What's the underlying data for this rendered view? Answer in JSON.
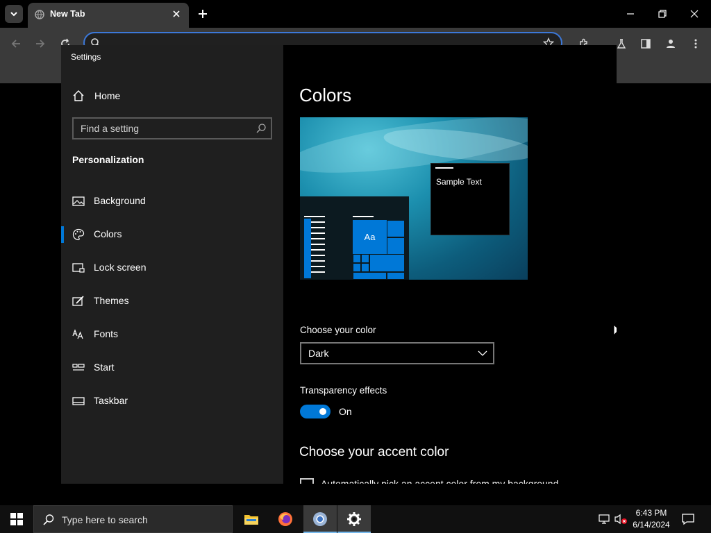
{
  "browser": {
    "tab_title": "New Tab",
    "omnibox_value": ""
  },
  "settings": {
    "window_title": "Settings",
    "home_label": "Home",
    "search_placeholder": "Find a setting",
    "section_heading": "Personalization",
    "nav_items": [
      {
        "label": "Background",
        "icon": "image-icon"
      },
      {
        "label": "Colors",
        "icon": "palette-icon",
        "selected": true
      },
      {
        "label": "Lock screen",
        "icon": "lock-screen-icon"
      },
      {
        "label": "Themes",
        "icon": "themes-icon"
      },
      {
        "label": "Fonts",
        "icon": "fonts-icon"
      },
      {
        "label": "Start",
        "icon": "start-icon"
      },
      {
        "label": "Taskbar",
        "icon": "taskbar-icon"
      }
    ],
    "page_title": "Colors",
    "preview_sample_text": "Sample Text",
    "preview_tile_text": "Aa",
    "choose_color_label": "Choose your color",
    "choose_color_value": "Dark",
    "transparency_label": "Transparency effects",
    "transparency_state": "On",
    "accent_heading": "Choose your accent color",
    "accent_auto_label": "Automatically pick an accent color from my background"
  },
  "taskbar": {
    "search_placeholder": "Type here to search",
    "time": "6:43 PM",
    "date": "6/14/2024"
  },
  "colors": {
    "accent": "#0078d7",
    "sidebar_bg": "#1f1f1f",
    "content_bg": "#000000",
    "browser_toolbar": "#3a3a3a"
  }
}
